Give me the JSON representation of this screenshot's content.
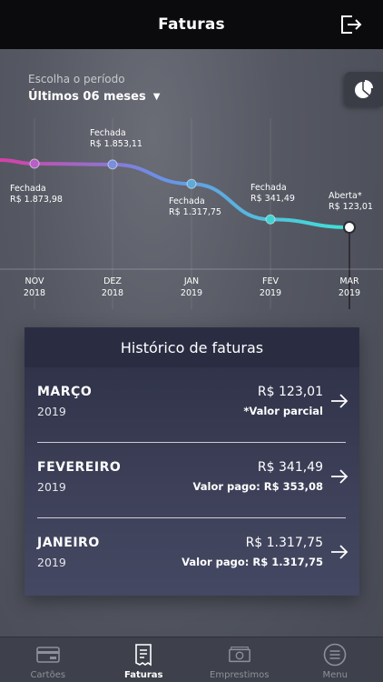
{
  "header": {
    "title": "Faturas"
  },
  "period": {
    "label": "Escolha o período",
    "selected": "Últimos 06 meses"
  },
  "chart_data": {
    "type": "line",
    "categories": [
      "NOV 2018",
      "DEZ 2018",
      "JAN 2019",
      "FEV 2019",
      "MAR 2019"
    ],
    "values": [
      1873.98,
      1853.11,
      1317.75,
      341.49,
      123.01
    ],
    "point_status": [
      "Fechada",
      "Fechada",
      "Fechada",
      "Fechada",
      "Aberta*"
    ],
    "point_values": [
      "R$ 1.873,98",
      "R$ 1.853,11",
      "R$ 1.317,75",
      "R$ 341,49",
      "R$ 123,01"
    ],
    "x_ticks": [
      {
        "month": "NOV",
        "year": "2018"
      },
      {
        "month": "DEZ",
        "year": "2018"
      },
      {
        "month": "JAN",
        "year": "2019"
      },
      {
        "month": "FEV",
        "year": "2019"
      },
      {
        "month": "MAR",
        "year": "2019"
      }
    ],
    "colors": {
      "start": "#d63fa6",
      "mid": "#6c8fe6",
      "end": "#3ee4d6"
    }
  },
  "history": {
    "title": "Histórico de faturas",
    "rows": [
      {
        "month": "MARÇO",
        "year": "2019",
        "amount": "R$ 123,01",
        "note": "*Valor parcial"
      },
      {
        "month": "FEVEREIRO",
        "year": "2019",
        "amount": "R$ 341,49",
        "note": "Valor pago: R$ 353,08"
      },
      {
        "month": "JANEIRO",
        "year": "2019",
        "amount": "R$ 1.317,75",
        "note": "Valor pago: R$ 1.317,75"
      }
    ]
  },
  "nav": {
    "items": [
      {
        "label": "Cartões",
        "icon": "card-icon",
        "active": false
      },
      {
        "label": "Faturas",
        "icon": "receipt-icon",
        "active": true
      },
      {
        "label": "Emprestimos",
        "icon": "cash-icon",
        "active": false
      },
      {
        "label": "Menu",
        "icon": "menu-icon",
        "active": false
      }
    ]
  }
}
